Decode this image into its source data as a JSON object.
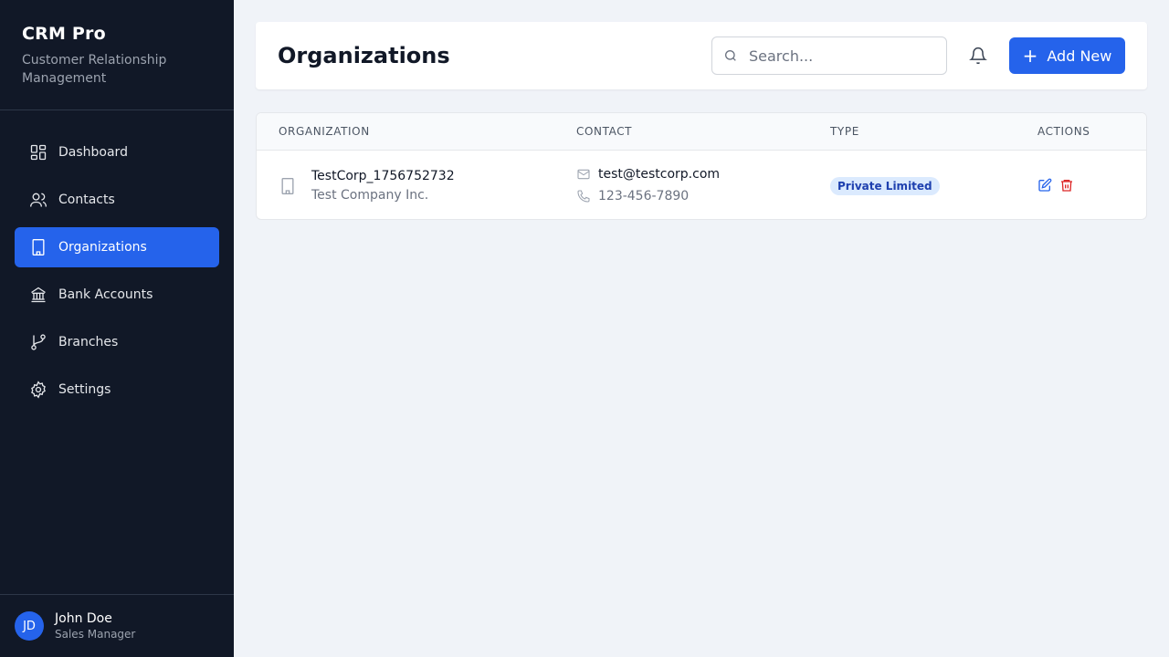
{
  "brand": {
    "title": "CRM Pro",
    "subtitle": "Customer Relationship Management"
  },
  "nav": [
    {
      "label": "Dashboard",
      "icon": "dashboard-icon"
    },
    {
      "label": "Contacts",
      "icon": "users-icon"
    },
    {
      "label": "Organizations",
      "icon": "building-icon",
      "active": true
    },
    {
      "label": "Bank Accounts",
      "icon": "bank-icon"
    },
    {
      "label": "Branches",
      "icon": "git-branch-icon"
    },
    {
      "label": "Settings",
      "icon": "gear-icon"
    }
  ],
  "user": {
    "initials": "JD",
    "name": "John Doe",
    "role": "Sales Manager"
  },
  "header": {
    "title": "Organizations",
    "search_placeholder": "Search...",
    "add_label": "Add New"
  },
  "table": {
    "columns": [
      "ORGANIZATION",
      "CONTACT",
      "TYPE",
      "ACTIONS"
    ],
    "rows": [
      {
        "name": "TestCorp_1756752732",
        "company": "Test Company Inc.",
        "email": "test@testcorp.com",
        "phone": "123-456-7890",
        "type": "Private Limited"
      }
    ]
  },
  "colors": {
    "sidebar_bg": "#111827",
    "accent": "#2563eb",
    "badge_bg": "#dbeafe",
    "badge_text": "#1e40af",
    "delete": "#dc2626"
  }
}
